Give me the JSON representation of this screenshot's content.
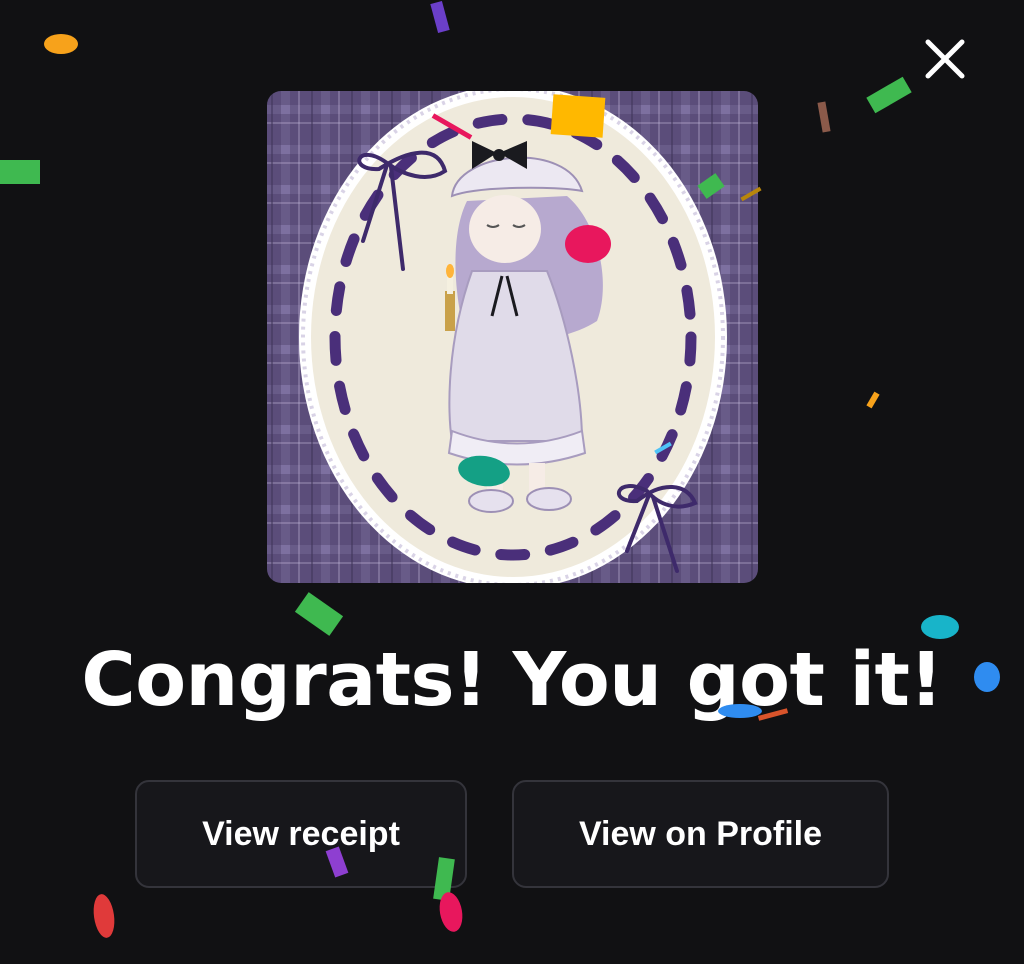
{
  "dialog": {
    "headline": "Congrats! You got it!",
    "close_icon": "close-icon"
  },
  "artwork": {
    "description_icon": "collectible-artwork"
  },
  "actions": {
    "view_receipt_label": "View receipt",
    "view_on_profile_label": "View on Profile"
  },
  "colors": {
    "background": "#111113",
    "button_background": "#17171b",
    "button_border": "#34343b",
    "text": "#ffffff",
    "plaid": "#5b4d7a",
    "oval": "#efeadc",
    "ribbon": "#4a2f7a"
  }
}
